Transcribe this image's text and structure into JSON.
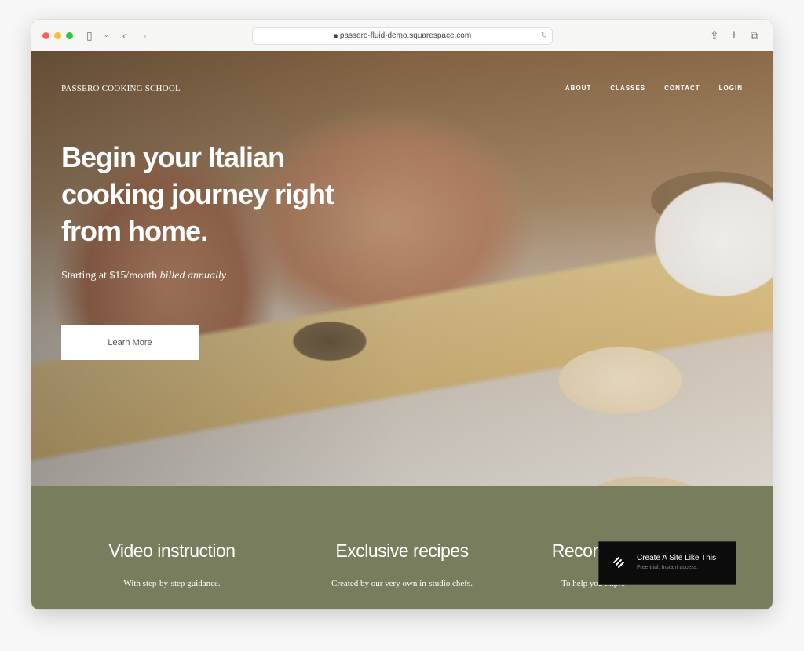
{
  "browser": {
    "url": "passero-fluid-demo.squarespace.com"
  },
  "site": {
    "logo": "PASSERO COOKING SCHOOL",
    "nav": [
      "ABOUT",
      "CLASSES",
      "CONTACT",
      "LOGIN"
    ],
    "headline": "Begin your Italian cooking journey right from home.",
    "subtitle": "Starting at $15/month",
    "subtitle_italic": "billed annually",
    "cta": "Learn More"
  },
  "features": [
    {
      "title": "Video instruction",
      "text": "With step-by-step guidance."
    },
    {
      "title": "Exclusive recipes",
      "text": "Created by our very own in-studio chefs."
    },
    {
      "title": "Recommended tools",
      "text": "To help you impro"
    }
  ],
  "badge": {
    "title": "Create A Site Like This",
    "subtitle": "Free trial. Instant access."
  },
  "colors": {
    "features_bg": "#787d5d",
    "badge_bg": "#0c0c0c"
  }
}
